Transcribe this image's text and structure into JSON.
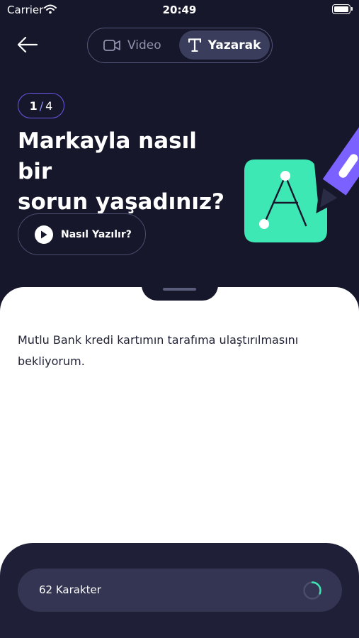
{
  "status_bar": {
    "carrier": "Carrier",
    "time": "20:49"
  },
  "header": {
    "mode_video_label": "Video",
    "mode_yazarak_label": "Yazarak",
    "selected_mode": "Yazarak"
  },
  "step": {
    "current": "1",
    "separator": "/",
    "total": "4"
  },
  "question": {
    "line1": "Markayla nasıl bir",
    "line2": "sorun yaşadınız?"
  },
  "how_to": {
    "label": "Nasıl Yazılır?"
  },
  "answer": {
    "text": "Mutlu Bank kredi kartımın tarafıma ulaştırılmasını bekliyorum."
  },
  "footer": {
    "char_count_label": "62 Karakter",
    "progress_fraction": 0.31
  },
  "colors": {
    "background": "#16172a",
    "accent_purple": "#6e56e8",
    "illustration_green": "#3de8b4",
    "pencil_purple": "#7b61ff",
    "progress_teal": "#3de8b4"
  },
  "icons": {
    "back": "arrow-left-icon",
    "video": "video-camera-icon",
    "yazarak": "text-t-icon",
    "play": "play-icon",
    "illustration": "writing-letter-a-illustration"
  }
}
